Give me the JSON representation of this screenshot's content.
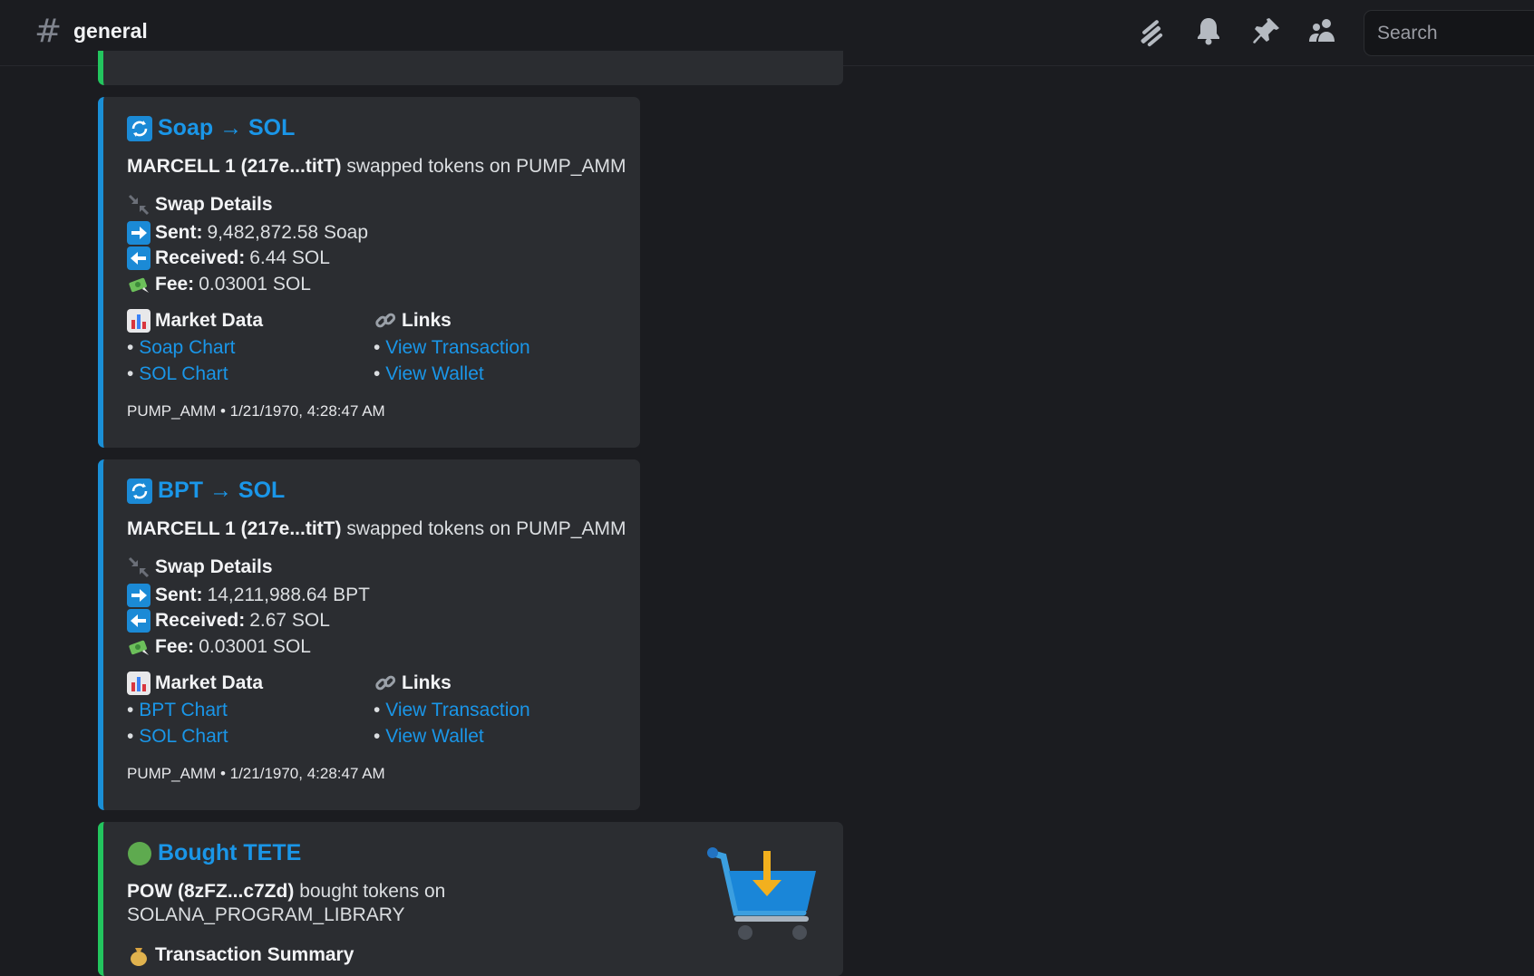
{
  "header": {
    "channel": "general",
    "search_placeholder": "Search"
  },
  "colors": {
    "accent_blue": "#1a96e8",
    "swap_border": "#1a8fd6",
    "buy_border": "#23c55e",
    "embed_bg": "#2b2d31"
  },
  "icons": [
    "threads-icon",
    "bell-icon",
    "pin-icon",
    "members-icon"
  ],
  "embeds": [
    {
      "title": "Soap → SOL",
      "actor": "MARCELL 1 (217e...titT)",
      "action": "swapped tokens on PUMP_AMM",
      "details_title": "Swap Details",
      "sent_label": "Sent:",
      "sent_value": "9,482,872.58 Soap",
      "received_label": "Received:",
      "received_value": "6.44 SOL",
      "fee_label": "Fee:",
      "fee_value": "0.03001 SOL",
      "market_title": "Market Data",
      "market_links": [
        "Soap Chart",
        "SOL Chart"
      ],
      "links_title": "Links",
      "links": [
        "View Transaction",
        "View Wallet"
      ],
      "footer": "PUMP_AMM • 1/21/1970, 4:28:47 AM"
    },
    {
      "title": "BPT → SOL",
      "actor": "MARCELL 1 (217e...titT)",
      "action": "swapped tokens on PUMP_AMM",
      "details_title": "Swap Details",
      "sent_label": "Sent:",
      "sent_value": "14,211,988.64 BPT",
      "received_label": "Received:",
      "received_value": "2.67 SOL",
      "fee_label": "Fee:",
      "fee_value": "0.03001 SOL",
      "market_title": "Market Data",
      "market_links": [
        "BPT Chart",
        "SOL Chart"
      ],
      "links_title": "Links",
      "links": [
        "View Transaction",
        "View Wallet"
      ],
      "footer": "PUMP_AMM • 1/21/1970, 4:28:47 AM"
    },
    {
      "title": "Bought TETE",
      "actor": "POW (8zFZ...c7Zd)",
      "action": "bought tokens on",
      "action_line2": "SOLANA_PROGRAM_LIBRARY",
      "summary_title": "Transaction Summary"
    }
  ]
}
